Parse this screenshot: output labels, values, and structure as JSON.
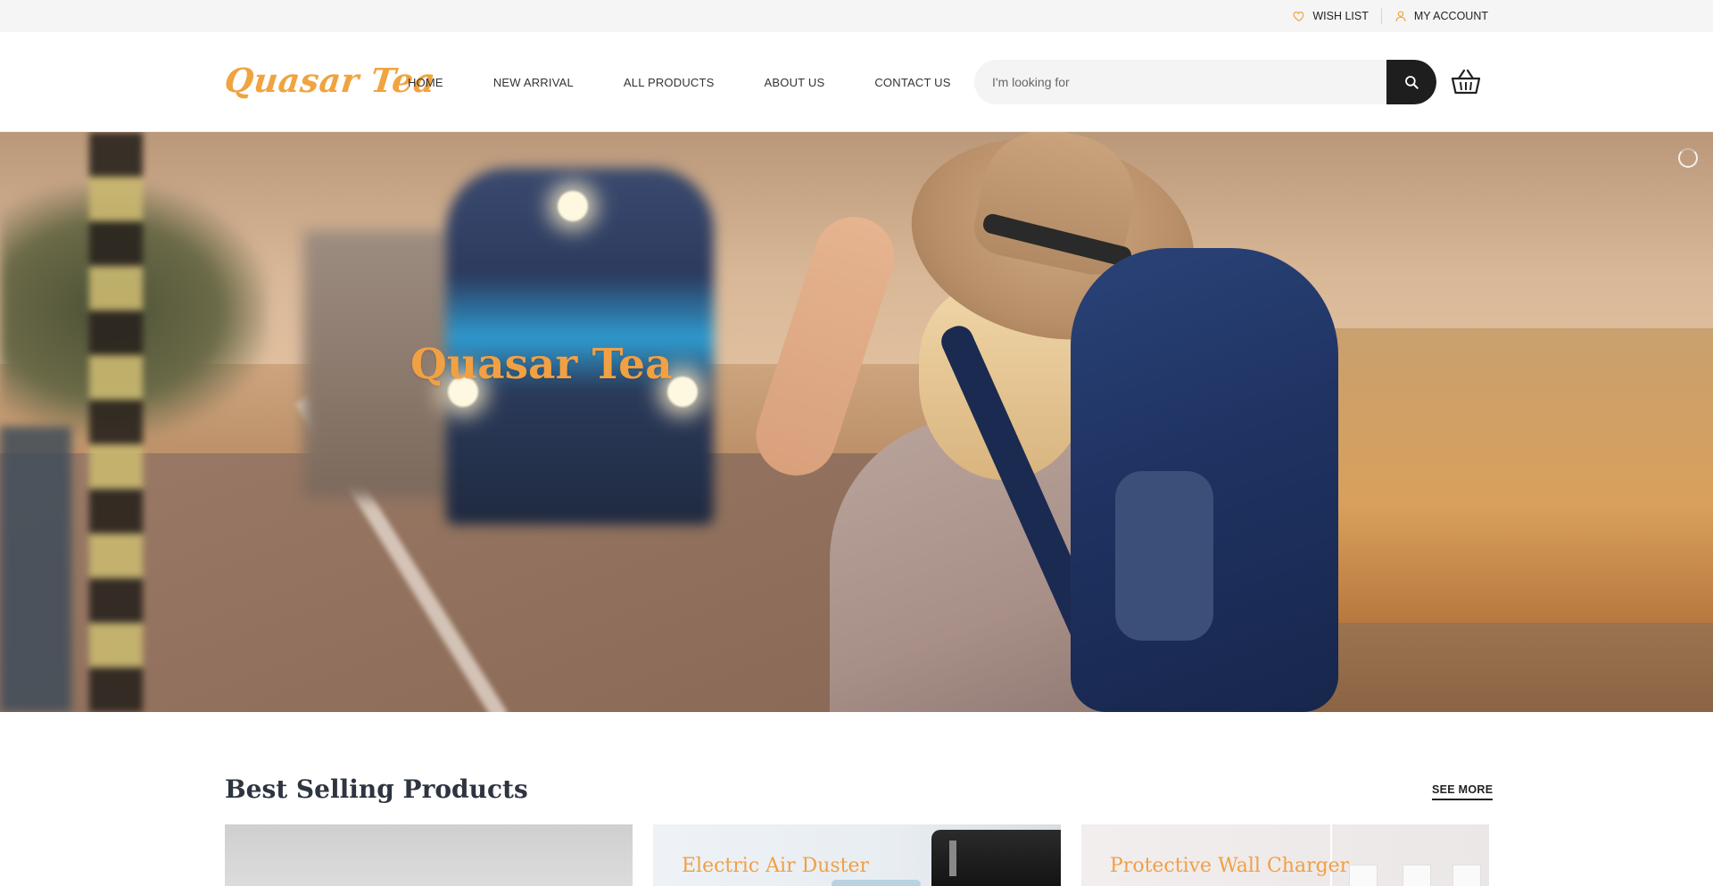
{
  "topbar": {
    "wishlist_label": "WISH LIST",
    "account_label": "MY ACCOUNT",
    "icon_color": "#f0a33f"
  },
  "header": {
    "logo_text": "Quasar Tea",
    "nav": [
      {
        "label": "HOME"
      },
      {
        "label": "NEW ARRIVAL"
      },
      {
        "label": "ALL PRODUCTS"
      },
      {
        "label": "ABOUT US"
      },
      {
        "label": "CONTACT US"
      }
    ],
    "search": {
      "placeholder": "I'm looking for",
      "value": ""
    },
    "icons": {
      "search": "search-icon",
      "cart": "basket-icon"
    }
  },
  "hero": {
    "title": "Quasar Tea",
    "accent": "#f2a044"
  },
  "best_selling": {
    "title": "Best Selling Products",
    "see_more": "SEE MORE",
    "products": [
      {
        "title": ""
      },
      {
        "title": "Electric Air Duster"
      },
      {
        "title": "Protective Wall Charger"
      }
    ]
  }
}
